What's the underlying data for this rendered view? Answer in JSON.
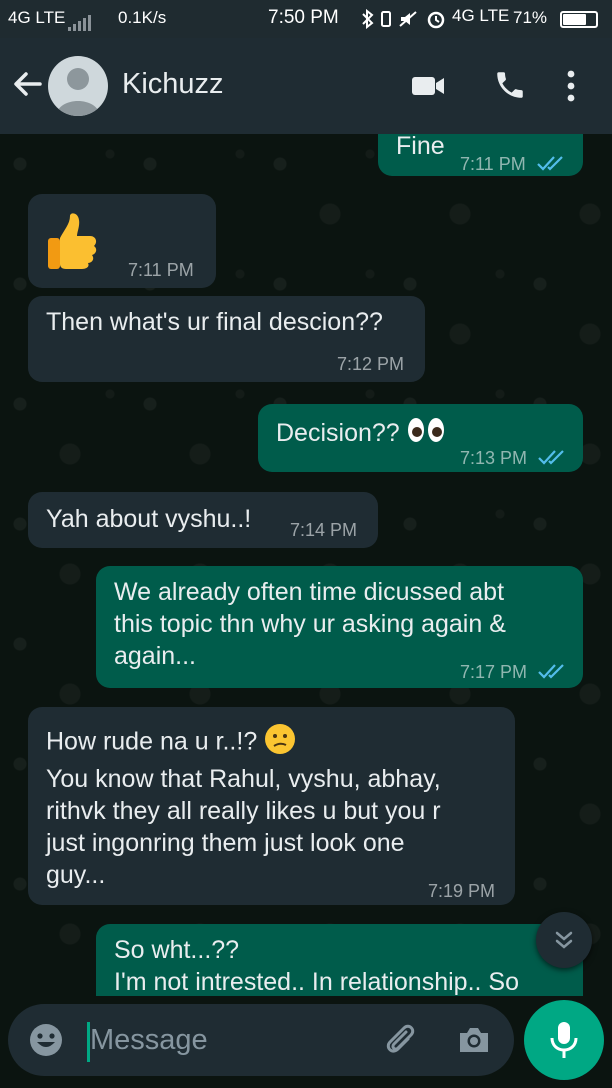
{
  "status_bar": {
    "network_left": "4G LTE",
    "speed": "0.1K/s",
    "time": "7:50 PM",
    "network_right": "4G LTE",
    "battery": "71%",
    "battery_level": 0.71
  },
  "header": {
    "contact_name": "Kichuzz",
    "back_icon": "arrow-left-icon",
    "video_icon": "video-camera-icon",
    "call_icon": "phone-icon",
    "menu_icon": "more-vert-icon"
  },
  "messages": [
    {
      "dir": "out",
      "text": "Fine",
      "time": "7:11 PM",
      "read": true
    },
    {
      "dir": "in",
      "emoji": "thumbs-up",
      "time": "7:11 PM"
    },
    {
      "dir": "in",
      "text": "Then what's ur final descion??",
      "time": "7:12 PM"
    },
    {
      "dir": "out",
      "text": "Decision??",
      "emoji": "eyes",
      "time": "7:13 PM",
      "read": true
    },
    {
      "dir": "in",
      "text": "Yah about vyshu..!",
      "time": "7:14 PM"
    },
    {
      "dir": "out",
      "lines": [
        "We already often time dicussed abt",
        "this topic thn why ur asking again &",
        "again..."
      ],
      "time": "7:17 PM",
      "read": true
    },
    {
      "dir": "in",
      "lines": [
        "How rude na u r..!?",
        "You know that Rahul, vyshu, abhay,",
        "rithvk they all really likes u but you r",
        "just ingonring them just look one",
        "guy..."
      ],
      "emoji": "confused-face",
      "time": "7:19 PM"
    },
    {
      "dir": "out",
      "lines": [
        "So wht...??",
        "I'm not intrested.. In relationship.. So"
      ]
    }
  ],
  "input": {
    "placeholder": "Message",
    "emoji_icon": "emoji-icon",
    "attach_icon": "paperclip-icon",
    "camera_icon": "camera-icon",
    "mic_icon": "mic-icon"
  },
  "scroll_icon": "double-chevron-down-icon",
  "colors": {
    "header": "#1f2c33",
    "incoming": "#1f2c33",
    "outgoing": "#005c4b",
    "accent": "#00a884",
    "read_tick": "#53bdeb"
  }
}
